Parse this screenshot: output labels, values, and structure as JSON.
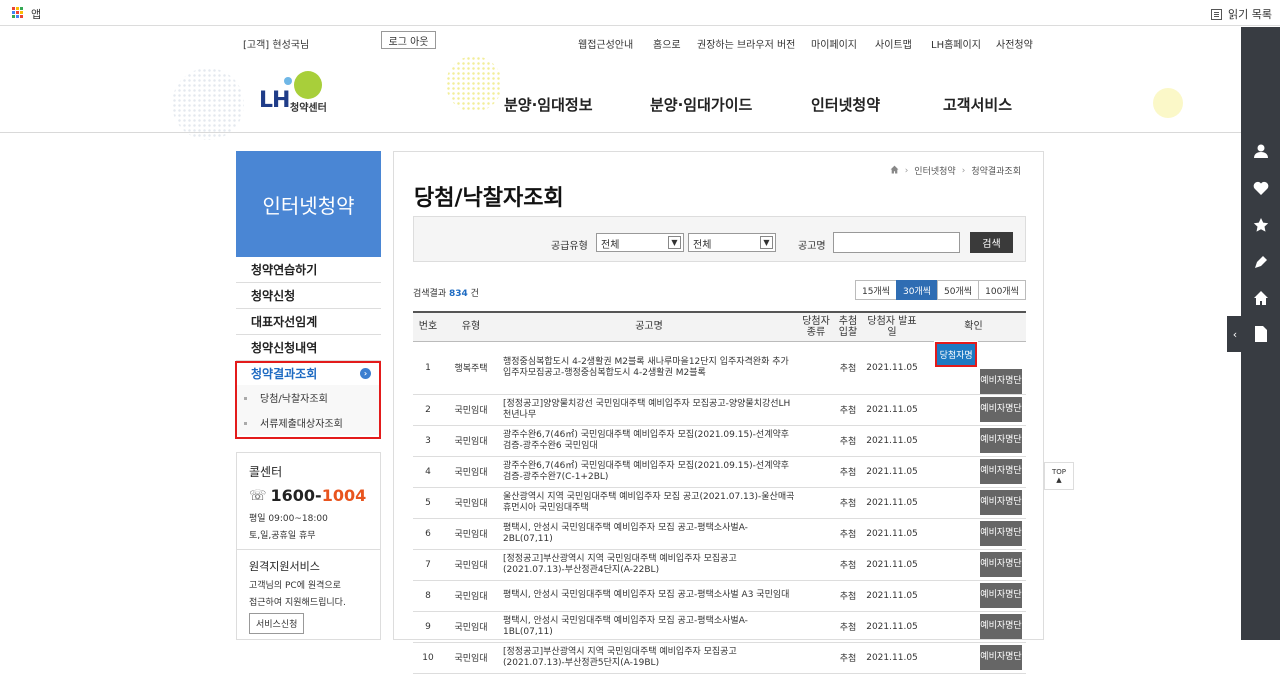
{
  "browser": {
    "apps_label": "앱",
    "reading_list_label": "읽기 목록"
  },
  "util": {
    "greeting": "[고객] 현성국님",
    "logout": "로그 아웃",
    "links": [
      "웹접근성안내",
      "홈으로",
      "권장하는 브라우저 버전",
      "마이페이지",
      "사이트맵",
      "LH홈페이지",
      "사전청약"
    ]
  },
  "logo": {
    "mark": "LH",
    "sub": "청약센터"
  },
  "gnb": [
    "분양·임대정보",
    "분양·임대가이드",
    "인터넷청약",
    "고객서비스"
  ],
  "lnb": {
    "title": "인터넷청약",
    "items": [
      "청약연습하기",
      "청약신청",
      "대표자선임계",
      "청약신청내역",
      "청약결과조회"
    ],
    "subitems": [
      "당첨/낙찰자조회",
      "서류제출대상자조회"
    ]
  },
  "callcenter": {
    "title": "콜센터",
    "number_a": "1600-",
    "number_b": "1004",
    "hours1": "평일 09:00~18:00",
    "hours2": "토,일,공휴일 휴무",
    "remote_title": "원격지원서비스",
    "remote_desc1": "고객님의 PC에 원격으로",
    "remote_desc2": "접근하여 지원해드립니다.",
    "remote_btn": "서비스신청"
  },
  "breadcrumb": [
    "인터넷청약",
    "청약결과조회"
  ],
  "page_title": "당첨/낙찰자조회",
  "search": {
    "type_label": "공급유형",
    "select1": "전체",
    "select2": "전체",
    "name_label": "공고명",
    "name_value": "",
    "button": "검색"
  },
  "result": {
    "prefix": "검색결과",
    "count": "834",
    "suffix": "건"
  },
  "pager": [
    "15개씩",
    "30개씩",
    "50개씩",
    "100개씩"
  ],
  "table": {
    "headers": [
      "번호",
      "유형",
      "공고명",
      "당첨자 종류",
      "추첨 입찰",
      "당첨자 발표일",
      "확인"
    ],
    "rows": [
      {
        "no": "1",
        "type": "행복주택",
        "title": "행정중심복합도시 4-2생활권 M2블록 새나루마을12단지 입주자격완화 추가입주자모집공고-행정중심복합도시 4-2생활권 M2블록",
        "draw": "추첨",
        "date": "2021.11.05",
        "win": "당첨자명단",
        "reserve": "예비자명단"
      },
      {
        "no": "2",
        "type": "국민임대",
        "title": "[정정공고]양양물치강선 국민임대주택 예비입주자 모집공고-양양물치강선LH 천년나무",
        "draw": "추첨",
        "date": "2021.11.05",
        "win": "",
        "reserve": "예비자명단"
      },
      {
        "no": "3",
        "type": "국민임대",
        "title": "광주수완6,7(46㎡) 국민임대주택 예비입주자 모집(2021.09.15)-선계약후검증-광주수완6 국민임대",
        "draw": "추첨",
        "date": "2021.11.05",
        "win": "",
        "reserve": "예비자명단"
      },
      {
        "no": "4",
        "type": "국민임대",
        "title": "광주수완6,7(46㎡) 국민임대주택 예비입주자 모집(2021.09.15)-선계약후검증-광주수완7(C-1+2BL)",
        "draw": "추첨",
        "date": "2021.11.05",
        "win": "",
        "reserve": "예비자명단"
      },
      {
        "no": "5",
        "type": "국민임대",
        "title": "울산광역시 지역 국민임대주택 예비입주자 모집 공고(2021.07.13)-울산매곡 휴먼시아 국민임대주택",
        "draw": "추첨",
        "date": "2021.11.05",
        "win": "",
        "reserve": "예비자명단"
      },
      {
        "no": "6",
        "type": "국민임대",
        "title": "평택시, 안성시 국민임대주택 예비입주자 모집 공고-평택소사벌A-2BL(07,11)",
        "draw": "추첨",
        "date": "2021.11.05",
        "win": "",
        "reserve": "예비자명단"
      },
      {
        "no": "7",
        "type": "국민임대",
        "title": "[정정공고]부산광역시 지역 국민임대주택 예비입주자 모집공고(2021.07.13)-부산정관4단지(A-22BL)",
        "draw": "추첨",
        "date": "2021.11.05",
        "win": "",
        "reserve": "예비자명단"
      },
      {
        "no": "8",
        "type": "국민임대",
        "title": "평택시, 안성시 국민임대주택 예비입주자 모집 공고-평택소사벌 A3 국민임대",
        "draw": "추첨",
        "date": "2021.11.05",
        "win": "",
        "reserve": "예비자명단"
      },
      {
        "no": "9",
        "type": "국민임대",
        "title": "평택시, 안성시 국민임대주택 예비입주자 모집 공고-평택소사벌A-1BL(07,11)",
        "draw": "추첨",
        "date": "2021.11.05",
        "win": "",
        "reserve": "예비자명단"
      },
      {
        "no": "10",
        "type": "국민임대",
        "title": "[정정공고]부산광역시 지역 국민임대주택 예비입주자 모집공고(2021.07.13)-부산정관5단지(A-19BL)",
        "draw": "추첨",
        "date": "2021.11.05",
        "win": "",
        "reserve": "예비자명단"
      }
    ]
  },
  "top_label": "TOP"
}
